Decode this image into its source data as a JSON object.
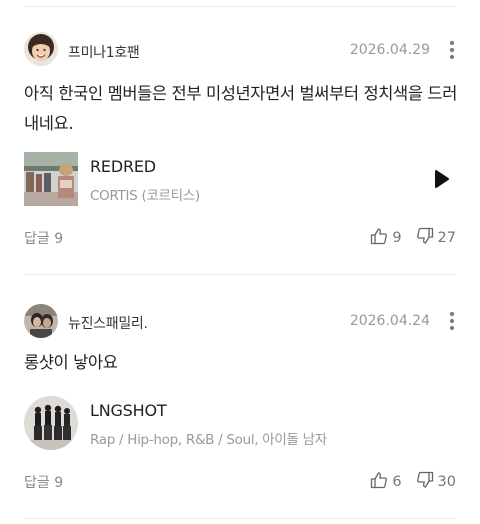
{
  "comments": [
    {
      "nickname": "프미나1호팬",
      "date": "2026.04.29",
      "text": "아직 한국인 멤버들은 전부 미성년자면서 벌써부터 정치색을 드러내네요.",
      "music": {
        "title": "REDRED",
        "subtitle": "CORTIS (코르티스)"
      },
      "reply_label": "답글 9",
      "likes": "9",
      "dislikes": "27"
    },
    {
      "nickname": "뉴진스패밀리.",
      "date": "2026.04.24",
      "text": "롱샷이 낳아요",
      "music": {
        "title": "LNGSHOT",
        "subtitle": "Rap / Hip-hop, R&B / Soul, 아이돌 남자"
      },
      "reply_label": "답글 9",
      "likes": "6",
      "dislikes": "30"
    }
  ],
  "icons": {
    "more": "more-vertical-icon",
    "play": "play-icon",
    "like": "thumbs-up-icon",
    "dislike": "thumbs-down-icon"
  },
  "colors": {
    "text": "#222222",
    "muted": "#999999",
    "divider": "#ececec"
  }
}
